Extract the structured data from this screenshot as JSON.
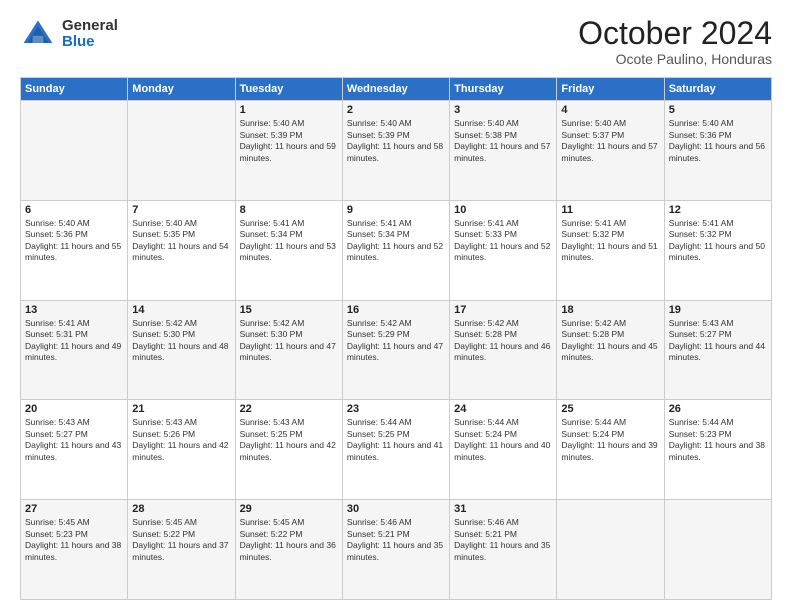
{
  "logo": {
    "general": "General",
    "blue": "Blue"
  },
  "title": "October 2024",
  "subtitle": "Ocote Paulino, Honduras",
  "days_header": [
    "Sunday",
    "Monday",
    "Tuesday",
    "Wednesday",
    "Thursday",
    "Friday",
    "Saturday"
  ],
  "weeks": [
    [
      {
        "num": "",
        "info": ""
      },
      {
        "num": "",
        "info": ""
      },
      {
        "num": "1",
        "info": "Sunrise: 5:40 AM\nSunset: 5:39 PM\nDaylight: 11 hours and 59 minutes."
      },
      {
        "num": "2",
        "info": "Sunrise: 5:40 AM\nSunset: 5:39 PM\nDaylight: 11 hours and 58 minutes."
      },
      {
        "num": "3",
        "info": "Sunrise: 5:40 AM\nSunset: 5:38 PM\nDaylight: 11 hours and 57 minutes."
      },
      {
        "num": "4",
        "info": "Sunrise: 5:40 AM\nSunset: 5:37 PM\nDaylight: 11 hours and 57 minutes."
      },
      {
        "num": "5",
        "info": "Sunrise: 5:40 AM\nSunset: 5:36 PM\nDaylight: 11 hours and 56 minutes."
      }
    ],
    [
      {
        "num": "6",
        "info": "Sunrise: 5:40 AM\nSunset: 5:36 PM\nDaylight: 11 hours and 55 minutes."
      },
      {
        "num": "7",
        "info": "Sunrise: 5:40 AM\nSunset: 5:35 PM\nDaylight: 11 hours and 54 minutes."
      },
      {
        "num": "8",
        "info": "Sunrise: 5:41 AM\nSunset: 5:34 PM\nDaylight: 11 hours and 53 minutes."
      },
      {
        "num": "9",
        "info": "Sunrise: 5:41 AM\nSunset: 5:34 PM\nDaylight: 11 hours and 52 minutes."
      },
      {
        "num": "10",
        "info": "Sunrise: 5:41 AM\nSunset: 5:33 PM\nDaylight: 11 hours and 52 minutes."
      },
      {
        "num": "11",
        "info": "Sunrise: 5:41 AM\nSunset: 5:32 PM\nDaylight: 11 hours and 51 minutes."
      },
      {
        "num": "12",
        "info": "Sunrise: 5:41 AM\nSunset: 5:32 PM\nDaylight: 11 hours and 50 minutes."
      }
    ],
    [
      {
        "num": "13",
        "info": "Sunrise: 5:41 AM\nSunset: 5:31 PM\nDaylight: 11 hours and 49 minutes."
      },
      {
        "num": "14",
        "info": "Sunrise: 5:42 AM\nSunset: 5:30 PM\nDaylight: 11 hours and 48 minutes."
      },
      {
        "num": "15",
        "info": "Sunrise: 5:42 AM\nSunset: 5:30 PM\nDaylight: 11 hours and 47 minutes."
      },
      {
        "num": "16",
        "info": "Sunrise: 5:42 AM\nSunset: 5:29 PM\nDaylight: 11 hours and 47 minutes."
      },
      {
        "num": "17",
        "info": "Sunrise: 5:42 AM\nSunset: 5:28 PM\nDaylight: 11 hours and 46 minutes."
      },
      {
        "num": "18",
        "info": "Sunrise: 5:42 AM\nSunset: 5:28 PM\nDaylight: 11 hours and 45 minutes."
      },
      {
        "num": "19",
        "info": "Sunrise: 5:43 AM\nSunset: 5:27 PM\nDaylight: 11 hours and 44 minutes."
      }
    ],
    [
      {
        "num": "20",
        "info": "Sunrise: 5:43 AM\nSunset: 5:27 PM\nDaylight: 11 hours and 43 minutes."
      },
      {
        "num": "21",
        "info": "Sunrise: 5:43 AM\nSunset: 5:26 PM\nDaylight: 11 hours and 42 minutes."
      },
      {
        "num": "22",
        "info": "Sunrise: 5:43 AM\nSunset: 5:25 PM\nDaylight: 11 hours and 42 minutes."
      },
      {
        "num": "23",
        "info": "Sunrise: 5:44 AM\nSunset: 5:25 PM\nDaylight: 11 hours and 41 minutes."
      },
      {
        "num": "24",
        "info": "Sunrise: 5:44 AM\nSunset: 5:24 PM\nDaylight: 11 hours and 40 minutes."
      },
      {
        "num": "25",
        "info": "Sunrise: 5:44 AM\nSunset: 5:24 PM\nDaylight: 11 hours and 39 minutes."
      },
      {
        "num": "26",
        "info": "Sunrise: 5:44 AM\nSunset: 5:23 PM\nDaylight: 11 hours and 38 minutes."
      }
    ],
    [
      {
        "num": "27",
        "info": "Sunrise: 5:45 AM\nSunset: 5:23 PM\nDaylight: 11 hours and 38 minutes."
      },
      {
        "num": "28",
        "info": "Sunrise: 5:45 AM\nSunset: 5:22 PM\nDaylight: 11 hours and 37 minutes."
      },
      {
        "num": "29",
        "info": "Sunrise: 5:45 AM\nSunset: 5:22 PM\nDaylight: 11 hours and 36 minutes."
      },
      {
        "num": "30",
        "info": "Sunrise: 5:46 AM\nSunset: 5:21 PM\nDaylight: 11 hours and 35 minutes."
      },
      {
        "num": "31",
        "info": "Sunrise: 5:46 AM\nSunset: 5:21 PM\nDaylight: 11 hours and 35 minutes."
      },
      {
        "num": "",
        "info": ""
      },
      {
        "num": "",
        "info": ""
      }
    ]
  ]
}
